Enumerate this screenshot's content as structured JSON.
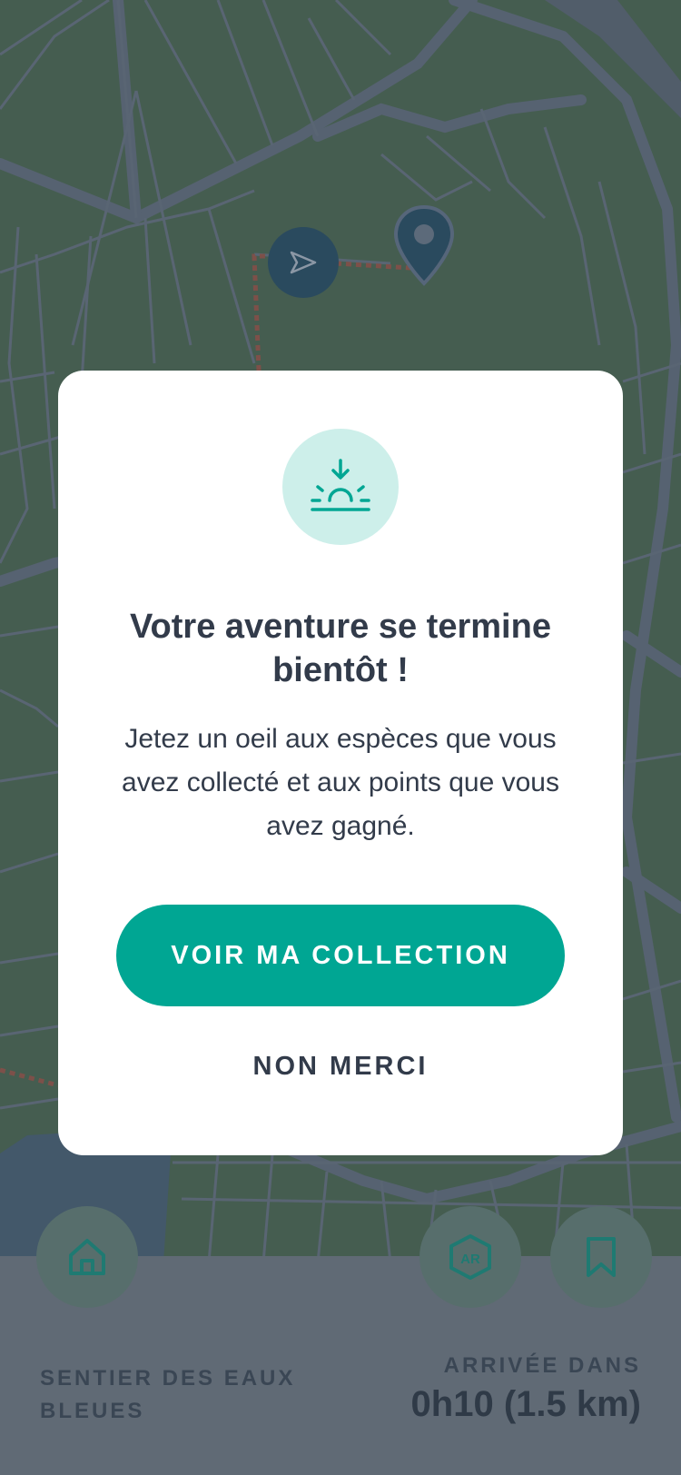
{
  "modal": {
    "icon": "sunset-icon",
    "title": "Votre aventure se termine bientôt !",
    "body": "Jetez un oeil aux espèces que vous avez collecté et aux points que vous avez gagné.",
    "primary_label": "VOIR MA COLLECTION",
    "secondary_label": "NON MERCI"
  },
  "map": {
    "user_icon": "navigation-arrow-icon",
    "destination_icon": "map-pin-icon"
  },
  "bottom_bar": {
    "home_icon": "home-icon",
    "ar_icon": "ar-cube-icon",
    "ar_label": "AR",
    "bookmark_icon": "bookmark-icon",
    "trail_name": "SENTIER DES EAUX BLEUES",
    "arrival_label": "ARRIVÉE DANS",
    "arrival_value": "0h10 (1.5 km)"
  },
  "colors": {
    "accent": "#00a693",
    "accent_light": "#cdefea",
    "text_dark": "#323b4a",
    "map_green": "#4f6b56"
  }
}
